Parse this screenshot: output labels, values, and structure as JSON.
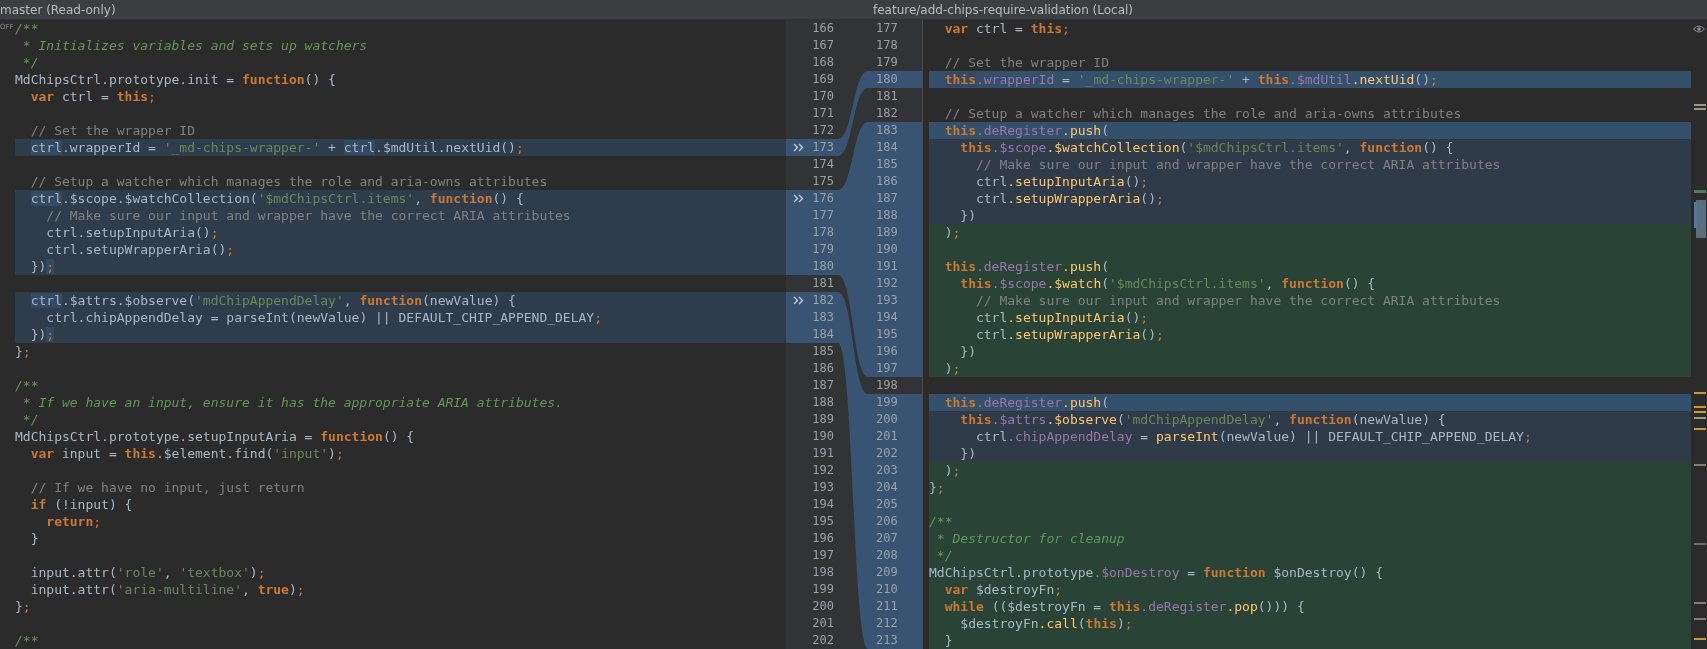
{
  "left_pane": {
    "title": "master (Read-only)",
    "margin_label": "OFF",
    "lines": [
      {
        "number": "166",
        "kind": "plain",
        "tokens": [
          {
            "text": "/**",
            "kind": "doc"
          }
        ]
      },
      {
        "number": "167",
        "kind": "plain",
        "tokens": [
          {
            "text": " * Initializes variables and sets up watchers",
            "kind": "doc"
          }
        ]
      },
      {
        "number": "168",
        "kind": "plain",
        "tokens": [
          {
            "text": " */",
            "kind": "doc"
          }
        ]
      },
      {
        "number": "169",
        "kind": "plain",
        "tokens": [
          {
            "text": "MdChipsCtrl.prototype.init = ",
            "kind": "plain"
          },
          {
            "text": "function",
            "kind": "keyword"
          },
          {
            "text": "() {",
            "kind": "plain"
          }
        ]
      },
      {
        "number": "170",
        "kind": "plain",
        "tokens": [
          {
            "text": "  var",
            "kind": "keyword"
          },
          {
            "text": " ctrl = ",
            "kind": "plain"
          },
          {
            "text": "this",
            "kind": "keyword"
          },
          {
            "text": ";",
            "kind": "punct"
          }
        ]
      },
      {
        "number": "171",
        "kind": "plain"
      },
      {
        "number": "172",
        "kind": "plain",
        "tokens": [
          {
            "text": "  // Set the wrapper ID",
            "kind": "comment"
          }
        ]
      },
      {
        "number": "173",
        "kind": "changed",
        "tokens": [
          {
            "text": "  ctrl",
            "kind": "mark"
          },
          {
            "text": ".wrapperId = ",
            "kind": "plain"
          },
          {
            "text": "'_md-chips-wrapper-'",
            "kind": "string"
          },
          {
            "text": " + ",
            "kind": "plain"
          },
          {
            "text": "ctrl",
            "kind": "mark"
          },
          {
            "text": ".$mdUtil.nextUid()",
            "kind": "plain"
          },
          {
            "text": ";",
            "kind": "punct"
          }
        ]
      },
      {
        "number": "174",
        "kind": "plain"
      },
      {
        "number": "175",
        "kind": "plain",
        "tokens": [
          {
            "text": "  // Setup a watcher which manages the role and aria-owns attributes",
            "kind": "comment"
          }
        ]
      },
      {
        "number": "176",
        "kind": "changed",
        "tokens": [
          {
            "text": "  ctrl",
            "kind": "mark"
          },
          {
            "text": ".$scope.$watchCollection(",
            "kind": "plain"
          },
          {
            "text": "'$mdChipsCtrl.items'",
            "kind": "string"
          },
          {
            "text": ", ",
            "kind": "plain"
          },
          {
            "text": "function",
            "kind": "keyword"
          },
          {
            "text": "() {",
            "kind": "plain"
          }
        ]
      },
      {
        "number": "177",
        "kind": "changed",
        "tokens": [
          {
            "text": "    // Make sure our input and wrapper have the correct ARIA attributes",
            "kind": "comment"
          }
        ]
      },
      {
        "number": "178",
        "kind": "changed",
        "tokens": [
          {
            "text": "    ctrl.setupInputAria()",
            "kind": "plain"
          },
          {
            "text": ";",
            "kind": "punct"
          }
        ]
      },
      {
        "number": "179",
        "kind": "changed",
        "tokens": [
          {
            "text": "    ctrl.setupWrapperAria()",
            "kind": "plain"
          },
          {
            "text": ";",
            "kind": "punct"
          }
        ]
      },
      {
        "number": "180",
        "kind": "changed",
        "tokens": [
          {
            "text": "  })",
            "kind": "plain"
          },
          {
            "text": ";",
            "kind": "punctmark"
          }
        ]
      },
      {
        "number": "181",
        "kind": "plain"
      },
      {
        "number": "182",
        "kind": "changed",
        "tokens": [
          {
            "text": "  ctrl",
            "kind": "mark"
          },
          {
            "text": ".$attrs.$observe(",
            "kind": "plain"
          },
          {
            "text": "'mdChipAppendDelay'",
            "kind": "string"
          },
          {
            "text": ", ",
            "kind": "plain"
          },
          {
            "text": "function",
            "kind": "keyword"
          },
          {
            "text": "(newValue) {",
            "kind": "plain"
          }
        ]
      },
      {
        "number": "183",
        "kind": "changed",
        "tokens": [
          {
            "text": "    ctrl.chipAppendDelay = parseInt(newValue) || DEFAULT_CHIP_APPEND_DELAY",
            "kind": "plain"
          },
          {
            "text": ";",
            "kind": "punct"
          }
        ]
      },
      {
        "number": "184",
        "kind": "changed",
        "tokens": [
          {
            "text": "  })",
            "kind": "plain"
          },
          {
            "text": ";",
            "kind": "punctmark"
          }
        ]
      },
      {
        "number": "185",
        "kind": "plain",
        "tokens": [
          {
            "text": "}",
            "kind": "plain"
          },
          {
            "text": ";",
            "kind": "punct"
          }
        ]
      },
      {
        "number": "186",
        "kind": "plain"
      },
      {
        "number": "187",
        "kind": "plain",
        "tokens": [
          {
            "text": "/**",
            "kind": "doc"
          }
        ]
      },
      {
        "number": "188",
        "kind": "plain",
        "tokens": [
          {
            "text": " * If we have an input, ensure it has the appropriate ARIA attributes.",
            "kind": "doc"
          }
        ]
      },
      {
        "number": "189",
        "kind": "plain",
        "tokens": [
          {
            "text": " */",
            "kind": "doc"
          }
        ]
      },
      {
        "number": "190",
        "kind": "plain",
        "tokens": [
          {
            "text": "MdChipsCtrl.prototype.setupInputAria = ",
            "kind": "plain"
          },
          {
            "text": "function",
            "kind": "keyword"
          },
          {
            "text": "() {",
            "kind": "plain"
          }
        ]
      },
      {
        "number": "191",
        "kind": "plain",
        "tokens": [
          {
            "text": "  var",
            "kind": "keyword"
          },
          {
            "text": " input = ",
            "kind": "plain"
          },
          {
            "text": "this",
            "kind": "keyword"
          },
          {
            "text": ".$element.find(",
            "kind": "plain"
          },
          {
            "text": "'input'",
            "kind": "string"
          },
          {
            "text": ")",
            "kind": "plain"
          },
          {
            "text": ";",
            "kind": "punct"
          }
        ]
      },
      {
        "number": "192",
        "kind": "plain"
      },
      {
        "number": "193",
        "kind": "plain",
        "tokens": [
          {
            "text": "  // If we have no input, just return",
            "kind": "comment"
          }
        ]
      },
      {
        "number": "194",
        "kind": "plain",
        "tokens": [
          {
            "text": "  if",
            "kind": "keyword"
          },
          {
            "text": " (!input) {",
            "kind": "plain"
          }
        ]
      },
      {
        "number": "195",
        "kind": "plain",
        "tokens": [
          {
            "text": "    return",
            "kind": "keyword"
          },
          {
            "text": ";",
            "kind": "punct"
          }
        ]
      },
      {
        "number": "196",
        "kind": "plain",
        "tokens": [
          {
            "text": "  }",
            "kind": "plain"
          }
        ]
      },
      {
        "number": "197",
        "kind": "plain"
      },
      {
        "number": "198",
        "kind": "plain",
        "tokens": [
          {
            "text": "  input.attr(",
            "kind": "plain"
          },
          {
            "text": "'role'",
            "kind": "string"
          },
          {
            "text": ", ",
            "kind": "plain"
          },
          {
            "text": "'textbox'",
            "kind": "string"
          },
          {
            "text": ")",
            "kind": "plain"
          },
          {
            "text": ";",
            "kind": "punct"
          }
        ]
      },
      {
        "number": "199",
        "kind": "plain",
        "tokens": [
          {
            "text": "  input.attr(",
            "kind": "plain"
          },
          {
            "text": "'aria-multiline'",
            "kind": "string"
          },
          {
            "text": ", ",
            "kind": "plain"
          },
          {
            "text": "true",
            "kind": "keyword"
          },
          {
            "text": ")",
            "kind": "plain"
          },
          {
            "text": ";",
            "kind": "punct"
          }
        ]
      },
      {
        "number": "200",
        "kind": "plain",
        "tokens": [
          {
            "text": "}",
            "kind": "plain"
          },
          {
            "text": ";",
            "kind": "punct"
          }
        ]
      },
      {
        "number": "201",
        "kind": "plain"
      },
      {
        "number": "202",
        "kind": "plain",
        "tokens": [
          {
            "text": "/**",
            "kind": "doc"
          }
        ]
      }
    ]
  },
  "right_pane": {
    "title": "feature/add-chips-require-validation (Local)",
    "lines": [
      {
        "number": "177",
        "kind": "plain",
        "tokens": [
          {
            "text": "  var",
            "kind": "keyword"
          },
          {
            "text": " ctrl = ",
            "kind": "plain"
          },
          {
            "text": "this",
            "kind": "keyword"
          },
          {
            "text": ";",
            "kind": "punct"
          }
        ]
      },
      {
        "number": "178",
        "kind": "plain"
      },
      {
        "number": "179",
        "kind": "plain",
        "tokens": [
          {
            "text": "  // Set the wrapper ID",
            "kind": "comment"
          }
        ]
      },
      {
        "number": "180",
        "kind": "focus",
        "tokens": [
          {
            "text": "  this",
            "kind": "keymark"
          },
          {
            "text": ".wrapperId",
            "kind": "field"
          },
          {
            "text": " = ",
            "kind": "plain"
          },
          {
            "text": "'_md-chips-wrapper-'",
            "kind": "string"
          },
          {
            "text": " + ",
            "kind": "plain"
          },
          {
            "text": "this",
            "kind": "keymark"
          },
          {
            "text": ".$mdUtil",
            "kind": "field"
          },
          {
            "text": ".nextUid",
            "kind": "call"
          },
          {
            "text": "()",
            "kind": "plain"
          },
          {
            "text": ";",
            "kind": "punct"
          }
        ]
      },
      {
        "number": "181",
        "kind": "plain"
      },
      {
        "number": "182",
        "kind": "plain",
        "tokens": [
          {
            "text": "  // Setup a watcher which manages the role and aria-owns attributes",
            "kind": "comment"
          }
        ]
      },
      {
        "number": "183",
        "kind": "focus",
        "tokens": [
          {
            "text": "  this",
            "kind": "keyword"
          },
          {
            "text": ".deRegister",
            "kind": "field"
          },
          {
            "text": ".push",
            "kind": "call"
          },
          {
            "text": "(",
            "kind": "plain"
          }
        ]
      },
      {
        "number": "184",
        "kind": "changed",
        "tokens": [
          {
            "text": "    this",
            "kind": "keyword"
          },
          {
            "text": ".$scope",
            "kind": "field"
          },
          {
            "text": ".$watchCollection",
            "kind": "call"
          },
          {
            "text": "(",
            "kind": "plain"
          },
          {
            "text": "'$mdChipsCtrl.items'",
            "kind": "string"
          },
          {
            "text": ", ",
            "kind": "plain"
          },
          {
            "text": "function",
            "kind": "keyword"
          },
          {
            "text": "() {",
            "kind": "plain"
          }
        ]
      },
      {
        "number": "185",
        "kind": "changed",
        "tokens": [
          {
            "text": "      // Make sure our input and wrapper have the correct ARIA attributes",
            "kind": "comment"
          }
        ]
      },
      {
        "number": "186",
        "kind": "changed",
        "tokens": [
          {
            "text": "      ctrl",
            "kind": "plain"
          },
          {
            "text": ".setupInputAria",
            "kind": "call"
          },
          {
            "text": "()",
            "kind": "plain"
          },
          {
            "text": ";",
            "kind": "punct"
          }
        ]
      },
      {
        "number": "187",
        "kind": "changed",
        "tokens": [
          {
            "text": "      ctrl",
            "kind": "plain"
          },
          {
            "text": ".setupWrapperAria",
            "kind": "call"
          },
          {
            "text": "()",
            "kind": "plain"
          },
          {
            "text": ";",
            "kind": "punct"
          }
        ]
      },
      {
        "number": "188",
        "kind": "changed",
        "tokens": [
          {
            "text": "    })",
            "kind": "plain"
          }
        ]
      },
      {
        "number": "189",
        "kind": "inserted",
        "tokens": [
          {
            "text": "  )",
            "kind": "plain"
          },
          {
            "text": ";",
            "kind": "punct"
          }
        ]
      },
      {
        "number": "190",
        "kind": "inserted"
      },
      {
        "number": "191",
        "kind": "inserted",
        "tokens": [
          {
            "text": "  this",
            "kind": "keyword"
          },
          {
            "text": ".deRegister",
            "kind": "field"
          },
          {
            "text": ".push",
            "kind": "call"
          },
          {
            "text": "(",
            "kind": "plain"
          }
        ]
      },
      {
        "number": "192",
        "kind": "inserted",
        "tokens": [
          {
            "text": "    this",
            "kind": "keyword"
          },
          {
            "text": ".$scope",
            "kind": "field"
          },
          {
            "text": ".$watch",
            "kind": "call"
          },
          {
            "text": "(",
            "kind": "plain"
          },
          {
            "text": "'$mdChipsCtrl.items'",
            "kind": "string"
          },
          {
            "text": ", ",
            "kind": "plain"
          },
          {
            "text": "function",
            "kind": "keyword"
          },
          {
            "text": "() {",
            "kind": "plain"
          }
        ]
      },
      {
        "number": "193",
        "kind": "inserted",
        "tokens": [
          {
            "text": "      // Make sure our input and wrapper have the correct ARIA attributes",
            "kind": "comment"
          }
        ]
      },
      {
        "number": "194",
        "kind": "inserted",
        "tokens": [
          {
            "text": "      ctrl",
            "kind": "plain"
          },
          {
            "text": ".setupInputAria",
            "kind": "call"
          },
          {
            "text": "()",
            "kind": "plain"
          },
          {
            "text": ";",
            "kind": "punct"
          }
        ]
      },
      {
        "number": "195",
        "kind": "inserted",
        "tokens": [
          {
            "text": "      ctrl",
            "kind": "plain"
          },
          {
            "text": ".setupWrapperAria",
            "kind": "call"
          },
          {
            "text": "()",
            "kind": "plain"
          },
          {
            "text": ";",
            "kind": "punct"
          }
        ]
      },
      {
        "number": "196",
        "kind": "inserted",
        "tokens": [
          {
            "text": "    })",
            "kind": "plain"
          }
        ]
      },
      {
        "number": "197",
        "kind": "inserted",
        "tokens": [
          {
            "text": "  )",
            "kind": "plain"
          },
          {
            "text": ";",
            "kind": "punct"
          }
        ]
      },
      {
        "number": "198",
        "kind": "plain"
      },
      {
        "number": "199",
        "kind": "focus",
        "tokens": [
          {
            "text": "  this",
            "kind": "keyword"
          },
          {
            "text": ".deRegister",
            "kind": "field"
          },
          {
            "text": ".push",
            "kind": "call"
          },
          {
            "text": "(",
            "kind": "plain"
          }
        ]
      },
      {
        "number": "200",
        "kind": "changed",
        "tokens": [
          {
            "text": "    this",
            "kind": "keyword"
          },
          {
            "text": ".$attrs",
            "kind": "field"
          },
          {
            "text": ".$observe",
            "kind": "call"
          },
          {
            "text": "(",
            "kind": "plain"
          },
          {
            "text": "'mdChipAppendDelay'",
            "kind": "string"
          },
          {
            "text": ", ",
            "kind": "plain"
          },
          {
            "text": "function",
            "kind": "keyword"
          },
          {
            "text": "(newValue) {",
            "kind": "plain"
          }
        ]
      },
      {
        "number": "201",
        "kind": "changed",
        "tokens": [
          {
            "text": "      ctrl",
            "kind": "plain"
          },
          {
            "text": ".chipAppendDelay",
            "kind": "field"
          },
          {
            "text": " = ",
            "kind": "plain"
          },
          {
            "text": "parseInt",
            "kind": "call"
          },
          {
            "text": "(newValue) || DEFAULT_CHIP_APPEND_DELAY",
            "kind": "plain"
          },
          {
            "text": ";",
            "kind": "punct"
          }
        ]
      },
      {
        "number": "202",
        "kind": "changed",
        "tokens": [
          {
            "text": "    })",
            "kind": "plain"
          }
        ]
      },
      {
        "number": "203",
        "kind": "inserted",
        "tokens": [
          {
            "text": "  )",
            "kind": "plain"
          },
          {
            "text": ";",
            "kind": "punct"
          }
        ]
      },
      {
        "number": "204",
        "kind": "inserted",
        "tokens": [
          {
            "text": "}",
            "kind": "plain"
          },
          {
            "text": ";",
            "kind": "punct"
          }
        ]
      },
      {
        "number": "205",
        "kind": "inserted"
      },
      {
        "number": "206",
        "kind": "inserted",
        "tokens": [
          {
            "text": "/**",
            "kind": "doc"
          }
        ]
      },
      {
        "number": "207",
        "kind": "inserted",
        "tokens": [
          {
            "text": " * Destructor for cleanup",
            "kind": "doc"
          }
        ]
      },
      {
        "number": "208",
        "kind": "inserted",
        "tokens": [
          {
            "text": " */",
            "kind": "doc"
          }
        ]
      },
      {
        "number": "209",
        "kind": "inserted",
        "tokens": [
          {
            "text": "MdChipsCtrl.prototype",
            "kind": "plain"
          },
          {
            "text": ".$onDestroy",
            "kind": "field"
          },
          {
            "text": " = ",
            "kind": "plain"
          },
          {
            "text": "function",
            "kind": "keyword"
          },
          {
            "text": " $onDestroy() {",
            "kind": "plain"
          }
        ]
      },
      {
        "number": "210",
        "kind": "inserted",
        "tokens": [
          {
            "text": "  var",
            "kind": "keyword"
          },
          {
            "text": " $destroyFn",
            "kind": "plain"
          },
          {
            "text": ";",
            "kind": "punct"
          }
        ]
      },
      {
        "number": "211",
        "kind": "inserted",
        "tokens": [
          {
            "text": "  while",
            "kind": "keyword"
          },
          {
            "text": " (($destroyFn = ",
            "kind": "plain"
          },
          {
            "text": "this",
            "kind": "keyword"
          },
          {
            "text": ".deRegister",
            "kind": "field"
          },
          {
            "text": ".pop",
            "kind": "call"
          },
          {
            "text": "())) {",
            "kind": "plain"
          }
        ]
      },
      {
        "number": "212",
        "kind": "inserted",
        "tokens": [
          {
            "text": "    $destroyFn",
            "kind": "plain"
          },
          {
            "text": ".call",
            "kind": "call"
          },
          {
            "text": "(",
            "kind": "plain"
          },
          {
            "text": "this",
            "kind": "keyword"
          },
          {
            "text": ")",
            "kind": "plain"
          },
          {
            "text": ";",
            "kind": "punct"
          }
        ]
      },
      {
        "number": "213",
        "kind": "inserted",
        "tokens": [
          {
            "text": "  }",
            "kind": "plain"
          }
        ]
      }
    ]
  }
}
